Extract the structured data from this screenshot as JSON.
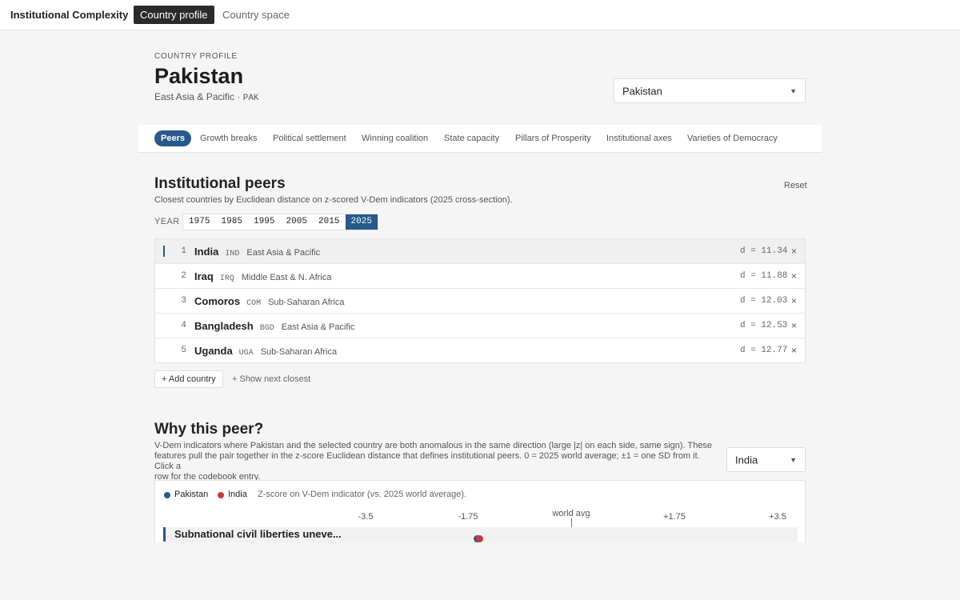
{
  "app": {
    "brand": "Institutional Complexity",
    "nav_tabs": [
      {
        "label": "Country profile",
        "active": true
      },
      {
        "label": "Country space",
        "active": false
      }
    ]
  },
  "profile": {
    "eyebrow": "COUNTRY PROFILE",
    "country": "Pakistan",
    "region": "East Asia & Pacific · ",
    "iso": "PAK",
    "selector_value": "Pakistan"
  },
  "subtabs": [
    {
      "label": "Peers",
      "active": true
    },
    {
      "label": "Growth breaks"
    },
    {
      "label": "Political settlement"
    },
    {
      "label": "Winning coalition"
    },
    {
      "label": "State capacity"
    },
    {
      "label": "Pillars of Prosperity"
    },
    {
      "label": "Institutional axes"
    },
    {
      "label": "Varieties of Democracy"
    }
  ],
  "peers_section": {
    "title": "Institutional peers",
    "subtitle": "Closest countries by Euclidean distance on z-scored V-Dem indicators (2025 cross-section).",
    "reset_label": "Reset",
    "year_label": "YEAR",
    "years": [
      {
        "label": "1975"
      },
      {
        "label": "1985"
      },
      {
        "label": "1995"
      },
      {
        "label": "2005"
      },
      {
        "label": "2015"
      },
      {
        "label": "2025",
        "active": true
      }
    ],
    "peers": [
      {
        "rank": "1",
        "name": "India",
        "iso": "IND",
        "region": "East Asia & Pacific",
        "distance": "d = 11.34",
        "remove": "×",
        "selected": true
      },
      {
        "rank": "2",
        "name": "Iraq",
        "iso": "IRQ",
        "region": "Middle East & N. Africa",
        "distance": "d = 11.88",
        "remove": "×"
      },
      {
        "rank": "3",
        "name": "Comoros",
        "iso": "COM",
        "region": "Sub-Saharan Africa",
        "distance": "d = 12.03",
        "remove": "×"
      },
      {
        "rank": "4",
        "name": "Bangladesh",
        "iso": "BGD",
        "region": "East Asia & Pacific",
        "distance": "d = 12.53",
        "remove": "×"
      },
      {
        "rank": "5",
        "name": "Uganda",
        "iso": "UGA",
        "region": "Sub-Saharan Africa",
        "distance": "d = 12.77",
        "remove": "×"
      }
    ],
    "add_country_label": "+ Add country",
    "show_next_label": "+ Show next closest"
  },
  "why_section": {
    "title": "Why this peer?",
    "description_lines": [
      "V-Dem indicators where Pakistan and the selected country are both anomalous in the same direction (large |z| on each side, same sign). These",
      "features pull the pair together in the z-score Euclidean distance that defines institutional peers. 0 = 2025 world average; ±1 = one SD from it. Click a",
      "row for the codebook entry."
    ],
    "peer_selector_value": "India",
    "legend": [
      {
        "label": "Pakistan",
        "color": "#27598b"
      },
      {
        "label": "India",
        "color": "#c83a3a"
      }
    ],
    "legend_note": "Z-score on V-Dem indicator (vs. 2025 world average).",
    "world_avg_label": "world avg",
    "ticks": [
      "-3.5",
      "-1.75",
      "+1.75",
      "+3.5"
    ],
    "rows": [
      {
        "label": "Subnational civil liberties uneve...",
        "pakistan_z": -1.6,
        "india_z": -1.55
      }
    ]
  },
  "colors": {
    "accent": "#27598b",
    "india": "#c83a3a",
    "nav_active": "#2b2b2b"
  }
}
